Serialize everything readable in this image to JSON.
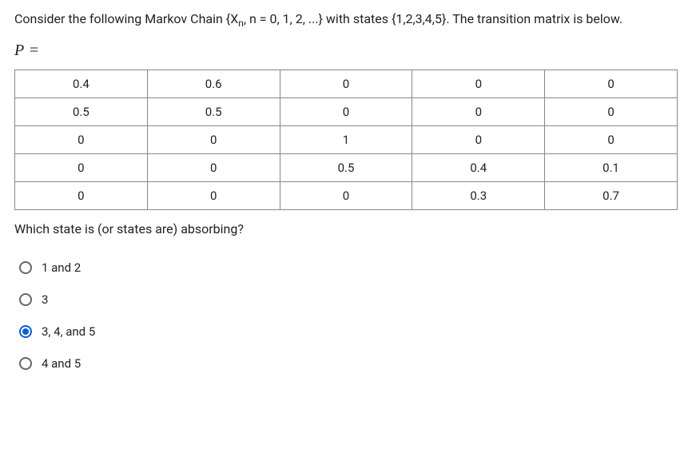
{
  "question": {
    "intro_html": "Consider the following Markov Chain {X<span class=\"sub\">n</span>, n = 0, 1, 2, ...} with states {1,2,3,4,5}.  The transition matrix is below.",
    "p_label": "P",
    "equals": "=",
    "matrix": [
      [
        "0.4",
        "0.6",
        "0",
        "0",
        "0"
      ],
      [
        "0.5",
        "0.5",
        "0",
        "0",
        "0"
      ],
      [
        "0",
        "0",
        "1",
        "0",
        "0"
      ],
      [
        "0",
        "0",
        "0.5",
        "0.4",
        "0.1"
      ],
      [
        "0",
        "0",
        "0",
        "0.3",
        "0.7"
      ]
    ],
    "prompt": "Which state is (or states are) absorbing?"
  },
  "options": [
    {
      "label": "1 and 2",
      "selected": false
    },
    {
      "label": "3",
      "selected": false
    },
    {
      "label": "3, 4, and 5",
      "selected": true
    },
    {
      "label": "4 and 5",
      "selected": false
    }
  ]
}
